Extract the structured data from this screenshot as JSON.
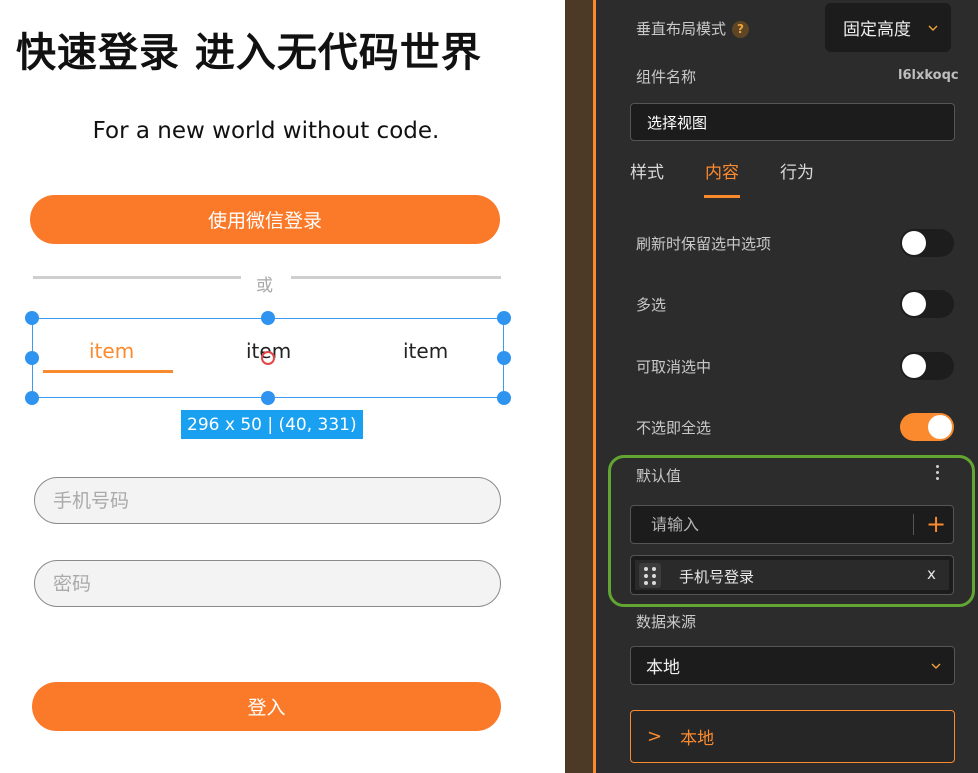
{
  "canvas": {
    "title": "快速登录 进入无代码世界",
    "subtitle": "For a new world without code.",
    "wechat_button": "使用微信登录",
    "or_text": "或",
    "tabs": [
      "item",
      "item",
      "item"
    ],
    "size_badge": "296 x 50 | (40, 331)",
    "phone_placeholder": "手机号码",
    "password_placeholder": "密码",
    "login_button": "登入"
  },
  "panel": {
    "vertical_layout_label": "垂直布局模式",
    "help_icon": "?",
    "vertical_layout_value": "固定高度",
    "component_name_label": "组件名称",
    "component_id": "l6lxkoqc",
    "component_name_value": "选择视图",
    "tabs": [
      "样式",
      "内容",
      "行为"
    ],
    "active_tab": "内容",
    "toggles": [
      {
        "label": "刷新时保留选中选项",
        "on": false
      },
      {
        "label": "多选",
        "on": false
      },
      {
        "label": "可取消选中",
        "on": false
      },
      {
        "label": "不选即全选",
        "on": true
      }
    ],
    "default_value_label": "默认值",
    "input_placeholder": "请输入",
    "add_icon": "+",
    "tag_label": "手机号登录",
    "tag_remove": "x",
    "data_source_label": "数据来源",
    "data_source_value": "本地",
    "local_button_arrow": ">",
    "local_button_label": "本地"
  },
  "colors": {
    "accent_orange": "#fb7a29",
    "selection_blue": "#2f94f0",
    "highlight_green": "#62a532",
    "panel_bg": "#2d2c2c"
  }
}
